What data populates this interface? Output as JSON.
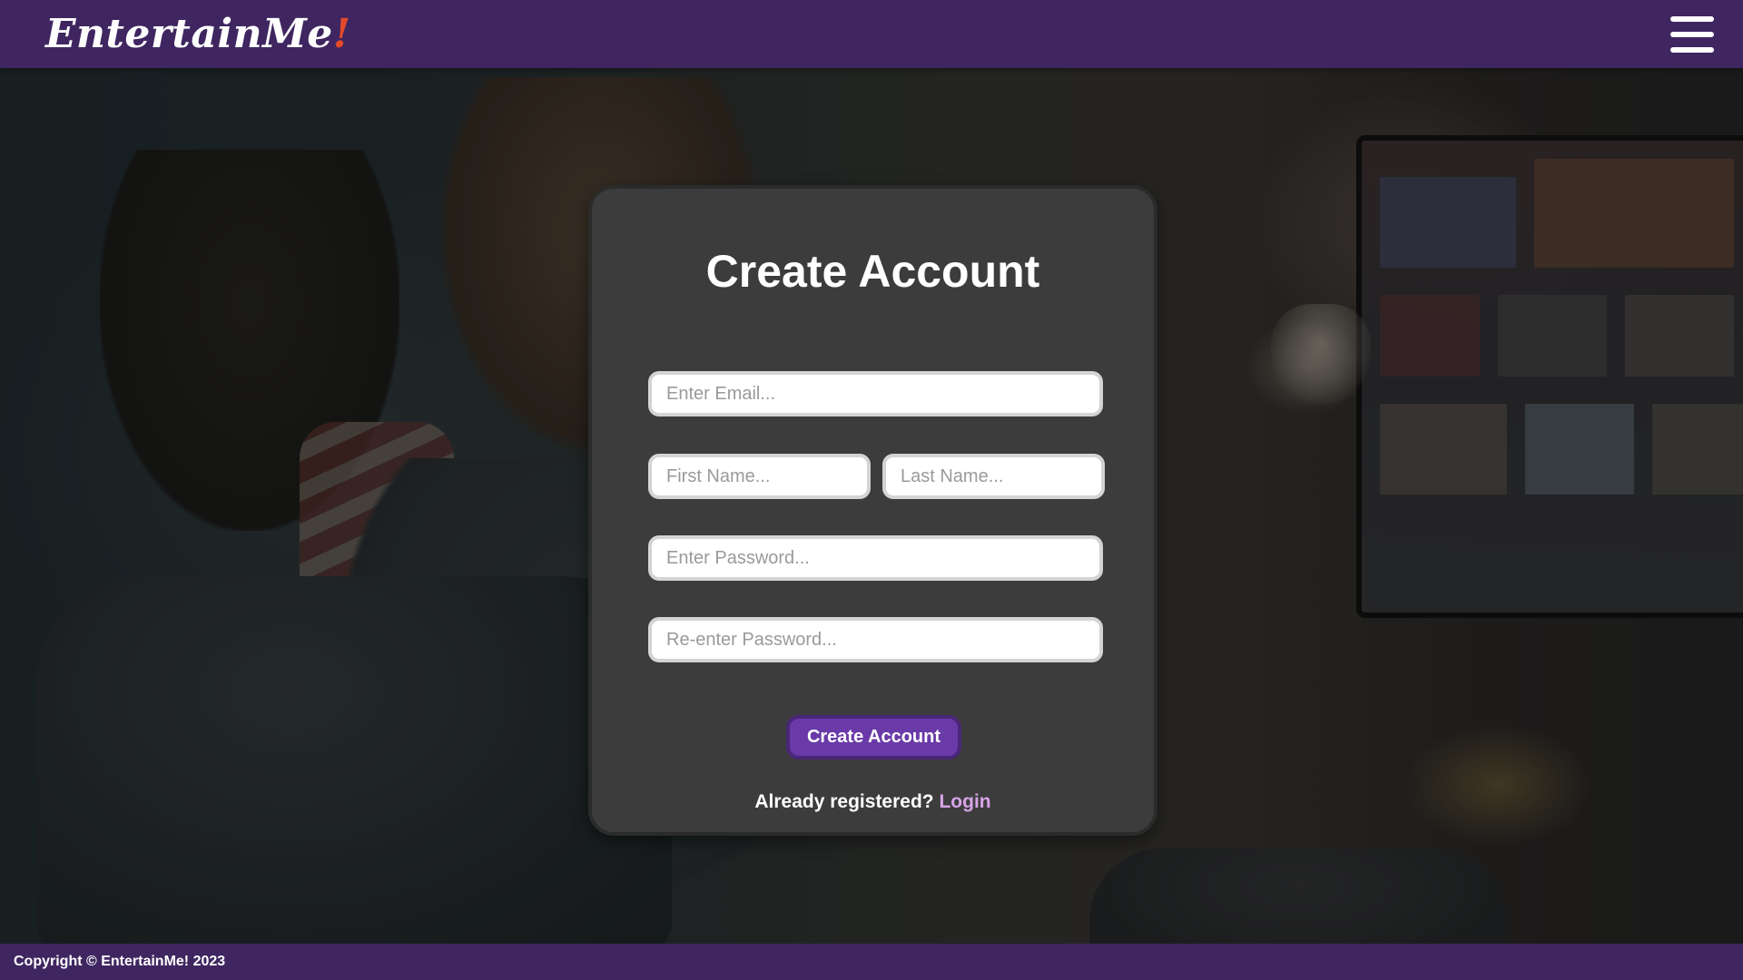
{
  "header": {
    "logo_text": "EntertainMe",
    "logo_bang": "!",
    "menu_icon": "hamburger-menu-icon"
  },
  "form": {
    "title": "Create Account",
    "email_placeholder": "Enter Email...",
    "first_name_placeholder": "First Name...",
    "last_name_placeholder": "Last Name...",
    "password_placeholder": "Enter Password...",
    "confirm_password_placeholder": "Re-enter Password...",
    "submit_label": "Create Account",
    "login_prompt": "Already registered?",
    "login_link": "Login"
  },
  "footer": {
    "copyright": "Copyright © EntertainMe! 2023"
  },
  "colors": {
    "brand_purple": "#3f2660",
    "button_purple": "#6a3aa8",
    "link_pink": "#d8a4e8",
    "logo_bang_orange": "#e24a2a",
    "card_bg": "#3c3c3c"
  }
}
